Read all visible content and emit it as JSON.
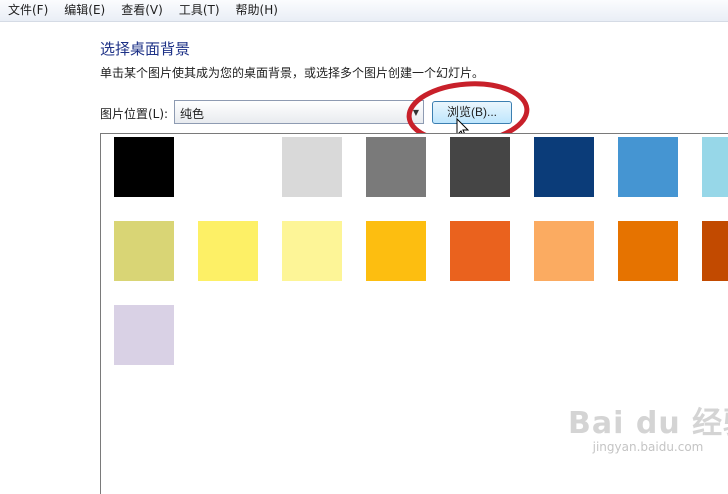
{
  "menu": [
    "文件(F)",
    "编辑(E)",
    "查看(V)",
    "工具(T)",
    "帮助(H)"
  ],
  "page": {
    "title": "选择桌面背景",
    "description": "单击某个图片使其成为您的桌面背景，或选择多个图片创建一个幻灯片。"
  },
  "picture_location": {
    "label": "图片位置(L):",
    "selected": "纯色",
    "browse_label": "浏览(B)..."
  },
  "colors": {
    "highlight_ellipse": "#c8202a",
    "panel_border": "#7a7a7a"
  },
  "swatches": [
    "#000000",
    "#ffffff",
    "#d9d9d9",
    "#7a7a7a",
    "#454545",
    "#0b3c79",
    "#4595d2",
    "#97d7e8",
    "#d9d575",
    "#fdf066",
    "#fdf597",
    "#fdbe10",
    "#ea621e",
    "#fbab61",
    "#e67300",
    "#c24a00",
    "#d9d1e5"
  ],
  "watermark": {
    "main": "Bai du 经验",
    "sub": "jingyan.baidu.com"
  }
}
